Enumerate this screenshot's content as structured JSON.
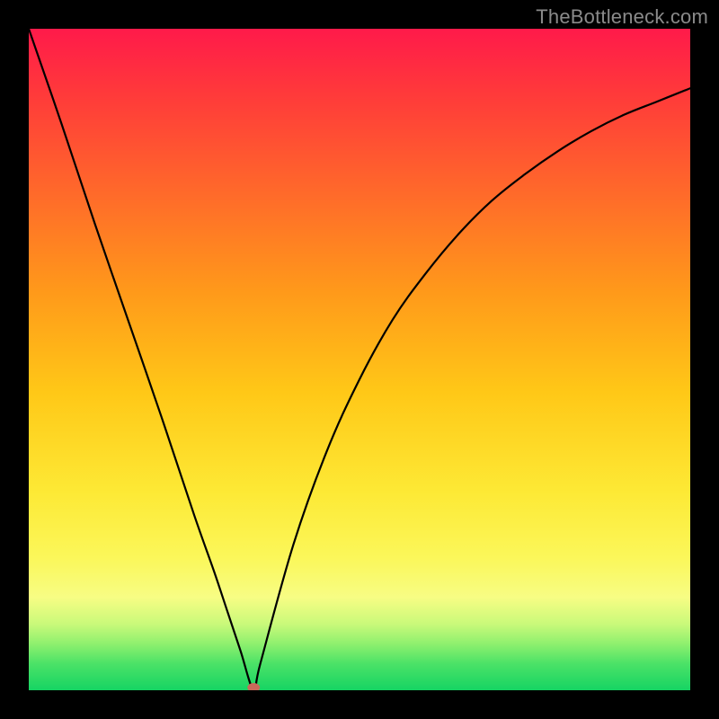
{
  "watermark": "TheBottleneck.com",
  "colors": {
    "background": "#000000",
    "gradient_top": "#ff1a4a",
    "gradient_bottom": "#16d463",
    "curve": "#000000",
    "marker": "#c96a5a"
  },
  "chart_data": {
    "type": "line",
    "title": "",
    "xlabel": "",
    "ylabel": "",
    "xlim": [
      0,
      100
    ],
    "ylim": [
      0,
      100
    ],
    "grid": false,
    "legend": false,
    "series": [
      {
        "name": "curve",
        "x": [
          0,
          5,
          10,
          15,
          20,
          25,
          28,
          30,
          32,
          34,
          35,
          40,
          45,
          50,
          55,
          60,
          65,
          70,
          75,
          80,
          85,
          90,
          95,
          100
        ],
        "y": [
          100,
          85.5,
          70.5,
          56,
          41.5,
          26.5,
          18,
          12,
          6,
          0,
          4,
          22,
          36,
          47,
          56,
          63,
          69,
          74,
          78,
          81.5,
          84.5,
          87,
          89,
          91
        ]
      }
    ],
    "marker": {
      "x": 34,
      "y": 0
    }
  }
}
